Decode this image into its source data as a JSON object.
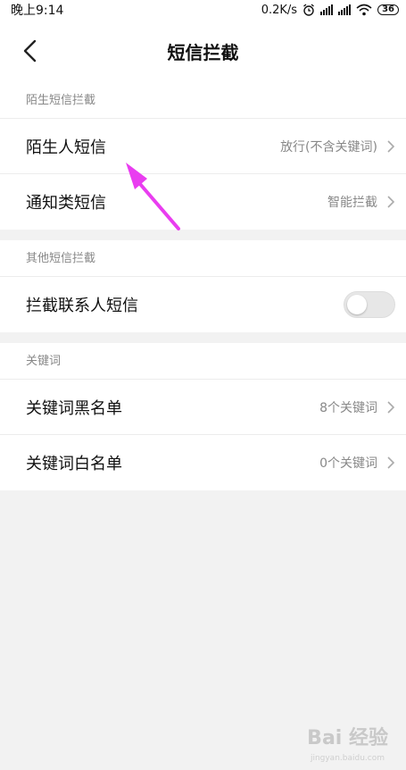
{
  "status_bar": {
    "time": "晚上9:14",
    "speed": "0.2K/s",
    "battery": "36"
  },
  "header": {
    "title": "短信拦截"
  },
  "sections": [
    {
      "label": "陌生短信拦截",
      "rows": [
        {
          "label": "陌生人短信",
          "value": "放行(不含关键词)"
        },
        {
          "label": "通知类短信",
          "value": "智能拦截"
        }
      ]
    },
    {
      "label": "其他短信拦截",
      "rows": [
        {
          "label": "拦截联系人短信",
          "toggle_on": false
        }
      ]
    },
    {
      "label": "关键词",
      "rows": [
        {
          "label": "关键词黑名单",
          "value": "8个关键词"
        },
        {
          "label": "关键词白名单",
          "value": "0个关键词"
        }
      ]
    }
  ],
  "watermark": {
    "text": "Bai 经验",
    "sub": "jingyan.baidu.com"
  },
  "colors": {
    "annotation_arrow": "#e93df0",
    "background": "#f2f2f2"
  }
}
